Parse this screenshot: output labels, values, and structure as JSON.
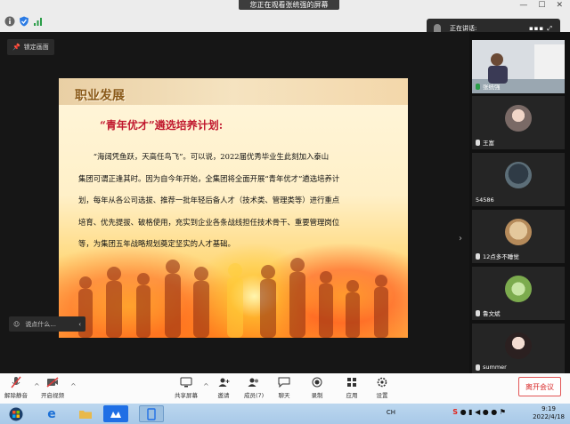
{
  "top": {
    "share_banner": "您正在观看张统强的屏幕",
    "speaker_label": "正在讲话:"
  },
  "stage": {
    "lock_label": "锁定画面",
    "chat_placeholder": "说点什么..."
  },
  "slide": {
    "title": "职业发展",
    "subtitle": "“青年优才”遴选培养计划:",
    "lines": [
      "　　“海阔凭鱼跃，天高任鸟飞”。可以说，2022届优秀毕业生此刻加入泰山",
      "集团可谓正逢其时。因为自今年开始，全集团将全面开展“青年优才”遴选培养计",
      "划，每年从各公司选拔、推荐一批年轻后备人才（技术类、管理类等）进行重点",
      "培育、优先提拔、破格使用，充实到企业各条战线担任技术骨干、重要管理岗位",
      "等，为集团五年战略规划奠定坚实的人才基础。"
    ]
  },
  "participants": [
    {
      "name": "张统强",
      "muted": false
    },
    {
      "name": "王富",
      "muted": false
    },
    {
      "name": "54586",
      "muted": false
    },
    {
      "name": "12点多不睡觉",
      "muted": false
    },
    {
      "name": "鲁文斌",
      "muted": false
    },
    {
      "name": "summer",
      "muted": false
    }
  ],
  "toolbar": {
    "mute": "解除静音",
    "video": "开启视频",
    "share": "共享屏幕",
    "invite": "邀请",
    "members": "成员(7)",
    "chat": "聊天",
    "record": "录制",
    "apps": "应用",
    "settings": "设置",
    "leave": "离开会议"
  },
  "taskbar": {
    "lang": "CH",
    "time": "9:19",
    "date": "2022/4/18"
  },
  "colors": {
    "accent": "#1f6fe5",
    "leave": "#d92c2c",
    "slide_title": "#c0172d"
  }
}
